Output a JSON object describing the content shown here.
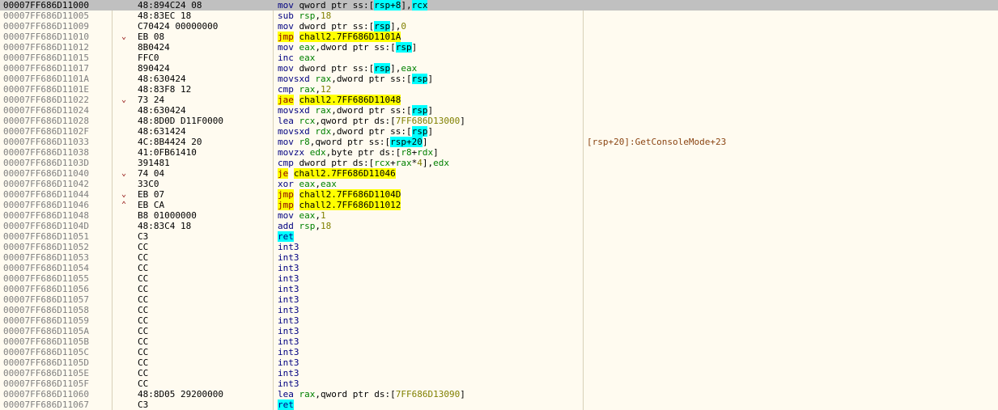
{
  "selected_index": 0,
  "rows": [
    {
      "addr": "00007FF686D11000",
      "bytes": "48:894C24 08",
      "arrow": "",
      "dis": [
        [
          "mn",
          "mov "
        ],
        [
          "p",
          "qword ptr "
        ],
        [
          "seg",
          "ss:"
        ],
        [
          "p",
          "["
        ],
        [
          "reg",
          "rsp",
          "cyan"
        ],
        [
          "imm",
          "+8",
          "cyan"
        ],
        [
          "p",
          "],"
        ],
        [
          "reg",
          "rcx",
          "cyan"
        ]
      ],
      "comment": ""
    },
    {
      "addr": "00007FF686D11005",
      "bytes": "48:83EC 18",
      "arrow": "",
      "dis": [
        [
          "mn",
          "sub "
        ],
        [
          "reg",
          "rsp"
        ],
        [
          "p",
          ","
        ],
        [
          "imm",
          "18"
        ]
      ],
      "comment": ""
    },
    {
      "addr": "00007FF686D11009",
      "bytes": "C70424 00000000",
      "arrow": "",
      "dis": [
        [
          "mn",
          "mov "
        ],
        [
          "p",
          "dword ptr "
        ],
        [
          "seg",
          "ss:"
        ],
        [
          "p",
          "["
        ],
        [
          "reg",
          "rsp",
          "cyan"
        ],
        [
          "p",
          "],"
        ],
        [
          "imm",
          "0"
        ]
      ],
      "comment": ""
    },
    {
      "addr": "00007FF686D11010",
      "bytes": "EB 08",
      "arrow": "⌄",
      "dis": [
        [
          "mn",
          "jmp",
          "yellow"
        ],
        [
          "p",
          " "
        ],
        [
          "p",
          "chall2.7FF686D1101A",
          "yellow"
        ]
      ],
      "comment": ""
    },
    {
      "addr": "00007FF686D11012",
      "bytes": "8B0424",
      "arrow": "",
      "dis": [
        [
          "mn",
          "mov "
        ],
        [
          "reg",
          "eax"
        ],
        [
          "p",
          ",dword ptr "
        ],
        [
          "seg",
          "ss:"
        ],
        [
          "p",
          "["
        ],
        [
          "reg",
          "rsp",
          "cyan"
        ],
        [
          "p",
          "]"
        ]
      ],
      "comment": ""
    },
    {
      "addr": "00007FF686D11015",
      "bytes": "FFC0",
      "arrow": "",
      "dis": [
        [
          "mn",
          "inc "
        ],
        [
          "reg",
          "eax"
        ]
      ],
      "comment": ""
    },
    {
      "addr": "00007FF686D11017",
      "bytes": "890424",
      "arrow": "",
      "dis": [
        [
          "mn",
          "mov "
        ],
        [
          "p",
          "dword ptr "
        ],
        [
          "seg",
          "ss:"
        ],
        [
          "p",
          "["
        ],
        [
          "reg",
          "rsp",
          "cyan"
        ],
        [
          "p",
          "],"
        ],
        [
          "reg",
          "eax"
        ]
      ],
      "comment": ""
    },
    {
      "addr": "00007FF686D1101A",
      "bytes": "48:630424",
      "arrow": "",
      "dis": [
        [
          "mn",
          "movsxd "
        ],
        [
          "reg",
          "rax"
        ],
        [
          "p",
          ",dword ptr "
        ],
        [
          "seg",
          "ss:"
        ],
        [
          "p",
          "["
        ],
        [
          "reg",
          "rsp",
          "cyan"
        ],
        [
          "p",
          "]"
        ]
      ],
      "comment": ""
    },
    {
      "addr": "00007FF686D1101E",
      "bytes": "48:83F8 12",
      "arrow": "",
      "dis": [
        [
          "mn",
          "cmp "
        ],
        [
          "reg",
          "rax"
        ],
        [
          "p",
          ","
        ],
        [
          "imm",
          "12"
        ]
      ],
      "comment": ""
    },
    {
      "addr": "00007FF686D11022",
      "bytes": "73 24",
      "arrow": "⌄",
      "dis": [
        [
          "mn",
          "jae",
          "yellow"
        ],
        [
          "p",
          " "
        ],
        [
          "p",
          "chall2.7FF686D11048",
          "yellow"
        ]
      ],
      "comment": ""
    },
    {
      "addr": "00007FF686D11024",
      "bytes": "48:630424",
      "arrow": "",
      "dis": [
        [
          "mn",
          "movsxd "
        ],
        [
          "reg",
          "rax"
        ],
        [
          "p",
          ",dword ptr "
        ],
        [
          "seg",
          "ss:"
        ],
        [
          "p",
          "["
        ],
        [
          "reg",
          "rsp",
          "cyan"
        ],
        [
          "p",
          "]"
        ]
      ],
      "comment": ""
    },
    {
      "addr": "00007FF686D11028",
      "bytes": "48:8D0D D11F0000",
      "arrow": "",
      "dis": [
        [
          "mn",
          "lea "
        ],
        [
          "reg",
          "rcx"
        ],
        [
          "p",
          ",qword ptr "
        ],
        [
          "seg",
          "ds:"
        ],
        [
          "p",
          "["
        ],
        [
          "imm",
          "7FF686D13000"
        ],
        [
          "p",
          "]"
        ]
      ],
      "comment": ""
    },
    {
      "addr": "00007FF686D1102F",
      "bytes": "48:631424",
      "arrow": "",
      "dis": [
        [
          "mn",
          "movsxd "
        ],
        [
          "reg",
          "rdx"
        ],
        [
          "p",
          ",dword ptr "
        ],
        [
          "seg",
          "ss:"
        ],
        [
          "p",
          "["
        ],
        [
          "reg",
          "rsp",
          "cyan"
        ],
        [
          "p",
          "]"
        ]
      ],
      "comment": ""
    },
    {
      "addr": "00007FF686D11033",
      "bytes": "4C:8B4424 20",
      "arrow": "",
      "dis": [
        [
          "mn",
          "mov "
        ],
        [
          "reg",
          "r8"
        ],
        [
          "p",
          ",qword ptr "
        ],
        [
          "seg",
          "ss:"
        ],
        [
          "p",
          "["
        ],
        [
          "reg",
          "rsp",
          "cyan"
        ],
        [
          "imm",
          "+20",
          "cyan"
        ],
        [
          "p",
          "]"
        ]
      ],
      "comment": "[rsp+20]:GetConsoleMode+23"
    },
    {
      "addr": "00007FF686D11038",
      "bytes": "41:0FB61410",
      "arrow": "",
      "dis": [
        [
          "mn",
          "movzx "
        ],
        [
          "reg",
          "edx"
        ],
        [
          "p",
          ",byte ptr "
        ],
        [
          "seg",
          "ds:"
        ],
        [
          "p",
          "["
        ],
        [
          "reg",
          "r8"
        ],
        [
          "p",
          "+"
        ],
        [
          "reg",
          "rdx"
        ],
        [
          "p",
          "]"
        ]
      ],
      "comment": ""
    },
    {
      "addr": "00007FF686D1103D",
      "bytes": "391481",
      "arrow": "",
      "dis": [
        [
          "mn",
          "cmp "
        ],
        [
          "p",
          "dword ptr "
        ],
        [
          "seg",
          "ds:"
        ],
        [
          "p",
          "["
        ],
        [
          "reg",
          "rcx"
        ],
        [
          "p",
          "+"
        ],
        [
          "reg",
          "rax"
        ],
        [
          "p",
          "*"
        ],
        [
          "imm",
          "4"
        ],
        [
          "p",
          "],"
        ],
        [
          "reg",
          "edx"
        ]
      ],
      "comment": ""
    },
    {
      "addr": "00007FF686D11040",
      "bytes": "74 04",
      "arrow": "⌄",
      "dis": [
        [
          "mn",
          "je",
          "yellow"
        ],
        [
          "p",
          " "
        ],
        [
          "p",
          "chall2.7FF686D11046",
          "yellow"
        ]
      ],
      "comment": ""
    },
    {
      "addr": "00007FF686D11042",
      "bytes": "33C0",
      "arrow": "",
      "dis": [
        [
          "mn",
          "xor "
        ],
        [
          "reg",
          "eax"
        ],
        [
          "p",
          ","
        ],
        [
          "reg",
          "eax"
        ]
      ],
      "comment": ""
    },
    {
      "addr": "00007FF686D11044",
      "bytes": "EB 07",
      "arrow": "⌄",
      "dis": [
        [
          "mn",
          "jmp",
          "yellow"
        ],
        [
          "p",
          " "
        ],
        [
          "p",
          "chall2.7FF686D1104D",
          "yellow"
        ]
      ],
      "comment": ""
    },
    {
      "addr": "00007FF686D11046",
      "bytes": "EB CA",
      "arrow": "⌃",
      "dis": [
        [
          "mn",
          "jmp",
          "yellow"
        ],
        [
          "p",
          " "
        ],
        [
          "p",
          "chall2.7FF686D11012",
          "yellow"
        ]
      ],
      "comment": ""
    },
    {
      "addr": "00007FF686D11048",
      "bytes": "B8 01000000",
      "arrow": "",
      "dis": [
        [
          "mn",
          "mov "
        ],
        [
          "reg",
          "eax"
        ],
        [
          "p",
          ","
        ],
        [
          "imm",
          "1"
        ]
      ],
      "comment": ""
    },
    {
      "addr": "00007FF686D1104D",
      "bytes": "48:83C4 18",
      "arrow": "",
      "dis": [
        [
          "mn",
          "add "
        ],
        [
          "reg",
          "rsp"
        ],
        [
          "p",
          ","
        ],
        [
          "imm",
          "18"
        ]
      ],
      "comment": ""
    },
    {
      "addr": "00007FF686D11051",
      "bytes": "C3",
      "arrow": "",
      "dis": [
        [
          "mn",
          "ret",
          "cyan"
        ]
      ],
      "comment": ""
    },
    {
      "addr": "00007FF686D11052",
      "bytes": "CC",
      "arrow": "",
      "dis": [
        [
          "mn",
          "int3"
        ]
      ],
      "comment": ""
    },
    {
      "addr": "00007FF686D11053",
      "bytes": "CC",
      "arrow": "",
      "dis": [
        [
          "mn",
          "int3"
        ]
      ],
      "comment": ""
    },
    {
      "addr": "00007FF686D11054",
      "bytes": "CC",
      "arrow": "",
      "dis": [
        [
          "mn",
          "int3"
        ]
      ],
      "comment": ""
    },
    {
      "addr": "00007FF686D11055",
      "bytes": "CC",
      "arrow": "",
      "dis": [
        [
          "mn",
          "int3"
        ]
      ],
      "comment": ""
    },
    {
      "addr": "00007FF686D11056",
      "bytes": "CC",
      "arrow": "",
      "dis": [
        [
          "mn",
          "int3"
        ]
      ],
      "comment": ""
    },
    {
      "addr": "00007FF686D11057",
      "bytes": "CC",
      "arrow": "",
      "dis": [
        [
          "mn",
          "int3"
        ]
      ],
      "comment": ""
    },
    {
      "addr": "00007FF686D11058",
      "bytes": "CC",
      "arrow": "",
      "dis": [
        [
          "mn",
          "int3"
        ]
      ],
      "comment": ""
    },
    {
      "addr": "00007FF686D11059",
      "bytes": "CC",
      "arrow": "",
      "dis": [
        [
          "mn",
          "int3"
        ]
      ],
      "comment": ""
    },
    {
      "addr": "00007FF686D1105A",
      "bytes": "CC",
      "arrow": "",
      "dis": [
        [
          "mn",
          "int3"
        ]
      ],
      "comment": ""
    },
    {
      "addr": "00007FF686D1105B",
      "bytes": "CC",
      "arrow": "",
      "dis": [
        [
          "mn",
          "int3"
        ]
      ],
      "comment": ""
    },
    {
      "addr": "00007FF686D1105C",
      "bytes": "CC",
      "arrow": "",
      "dis": [
        [
          "mn",
          "int3"
        ]
      ],
      "comment": ""
    },
    {
      "addr": "00007FF686D1105D",
      "bytes": "CC",
      "arrow": "",
      "dis": [
        [
          "mn",
          "int3"
        ]
      ],
      "comment": ""
    },
    {
      "addr": "00007FF686D1105E",
      "bytes": "CC",
      "arrow": "",
      "dis": [
        [
          "mn",
          "int3"
        ]
      ],
      "comment": ""
    },
    {
      "addr": "00007FF686D1105F",
      "bytes": "CC",
      "arrow": "",
      "dis": [
        [
          "mn",
          "int3"
        ]
      ],
      "comment": ""
    },
    {
      "addr": "00007FF686D11060",
      "bytes": "48:8D05 29200000",
      "arrow": "",
      "dis": [
        [
          "mn",
          "lea "
        ],
        [
          "reg",
          "rax"
        ],
        [
          "p",
          ",qword ptr "
        ],
        [
          "seg",
          "ds:"
        ],
        [
          "p",
          "["
        ],
        [
          "imm",
          "7FF686D13090"
        ],
        [
          "p",
          "]"
        ]
      ],
      "comment": ""
    },
    {
      "addr": "00007FF686D11067",
      "bytes": "C3",
      "arrow": "",
      "dis": [
        [
          "mn",
          "ret",
          "cyan"
        ]
      ],
      "comment": ""
    }
  ]
}
